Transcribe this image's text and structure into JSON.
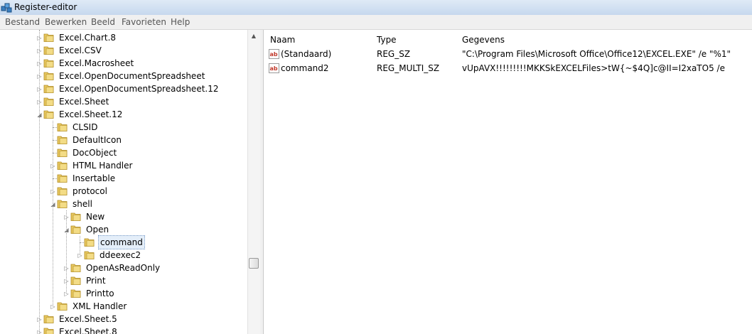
{
  "window": {
    "title": "Register-editor"
  },
  "menu": [
    "Bestand",
    "Bewerken",
    "Beeld",
    "Favorieten",
    "Help"
  ],
  "tree": [
    {
      "label": "Excel.Chart.8",
      "level": 0,
      "expander": "collapsed"
    },
    {
      "label": "Excel.CSV",
      "level": 0,
      "expander": "collapsed"
    },
    {
      "label": "Excel.Macrosheet",
      "level": 0,
      "expander": "collapsed"
    },
    {
      "label": "Excel.OpenDocumentSpreadsheet",
      "level": 0,
      "expander": "collapsed"
    },
    {
      "label": "Excel.OpenDocumentSpreadsheet.12",
      "level": 0,
      "expander": "collapsed"
    },
    {
      "label": "Excel.Sheet",
      "level": 0,
      "expander": "collapsed"
    },
    {
      "label": "Excel.Sheet.12",
      "level": 0,
      "expander": "expanded"
    },
    {
      "label": "CLSID",
      "level": 1,
      "expander": "none"
    },
    {
      "label": "DefaultIcon",
      "level": 1,
      "expander": "none"
    },
    {
      "label": "DocObject",
      "level": 1,
      "expander": "none"
    },
    {
      "label": "HTML Handler",
      "level": 1,
      "expander": "collapsed"
    },
    {
      "label": "Insertable",
      "level": 1,
      "expander": "none"
    },
    {
      "label": "protocol",
      "level": 1,
      "expander": "collapsed"
    },
    {
      "label": "shell",
      "level": 1,
      "expander": "expanded"
    },
    {
      "label": "New",
      "level": 2,
      "expander": "collapsed"
    },
    {
      "label": "Open",
      "level": 2,
      "expander": "expanded"
    },
    {
      "label": "command",
      "level": 3,
      "expander": "none",
      "selected": true
    },
    {
      "label": "ddeexec2",
      "level": 3,
      "expander": "collapsed"
    },
    {
      "label": "OpenAsReadOnly",
      "level": 2,
      "expander": "collapsed"
    },
    {
      "label": "Print",
      "level": 2,
      "expander": "collapsed"
    },
    {
      "label": "Printto",
      "level": 2,
      "expander": "collapsed"
    },
    {
      "label": "XML Handler",
      "level": 1,
      "expander": "collapsed"
    },
    {
      "label": "Excel.Sheet.5",
      "level": 0,
      "expander": "collapsed"
    },
    {
      "label": "Excel.Sheet.8",
      "level": 0,
      "expander": "collapsed"
    }
  ],
  "list": {
    "columns": [
      "Naam",
      "Type",
      "Gegevens"
    ],
    "rows": [
      {
        "name": "(Standaard)",
        "type": "REG_SZ",
        "data": "\"C:\\Program Files\\Microsoft Office\\Office12\\EXCEL.EXE\" /e \"%1\"",
        "icon": "string-value-icon"
      },
      {
        "name": "command2",
        "type": "REG_MULTI_SZ",
        "data": "vUpAVX!!!!!!!!!MKKSkEXCELFiles>tW{~$4Q]c@II=I2xaTO5 /e",
        "icon": "string-value-icon"
      }
    ]
  },
  "colors": {
    "folder": "#e8c860",
    "selection": "#e4eef9",
    "value_icon": "#c0392b"
  }
}
